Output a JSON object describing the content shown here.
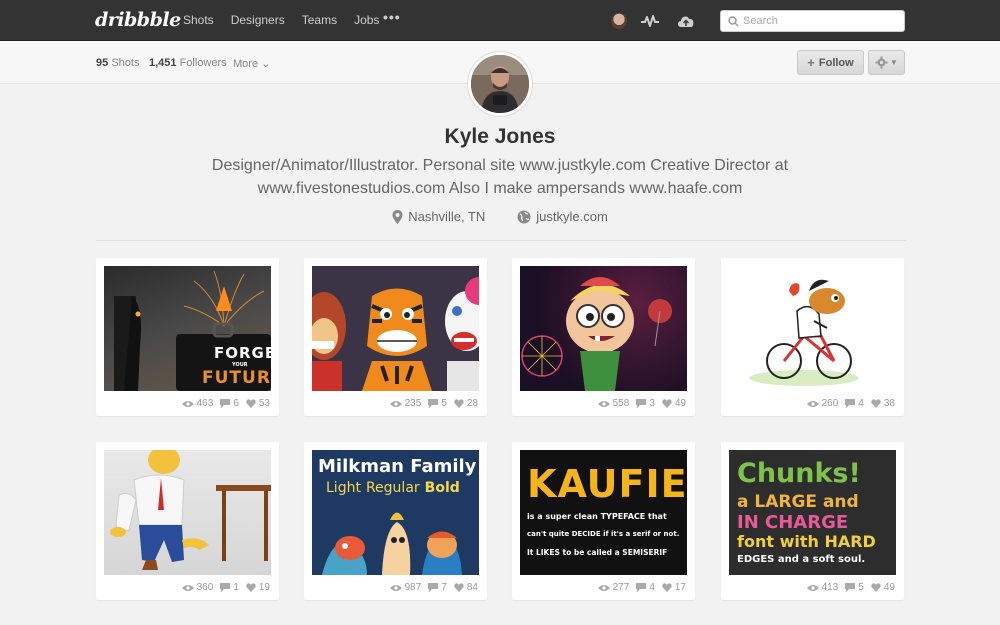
{
  "topnav": {
    "logo": "dribbble",
    "links": [
      "Shots",
      "Designers",
      "Teams",
      "Jobs"
    ],
    "more": "•••",
    "search_placeholder": "Search"
  },
  "subbar": {
    "shots_count": "95",
    "shots_label": "Shots",
    "followers_count": "1,451",
    "followers_label": "Followers",
    "more_label": "More",
    "follow_label": "Follow"
  },
  "profile": {
    "name": "Kyle Jones",
    "bio_line1": "Designer/Animator/Illustrator. Personal site www.justkyle.com Creative Director at",
    "bio_line2": "www.fivestonestudios.com Also I make ampersands www.haafe.com",
    "location": "Nashville, TN",
    "website": "justkyle.com"
  },
  "shots": [
    {
      "views": "463",
      "comments": "6",
      "likes": "53",
      "art": {
        "line1": "FORGE",
        "line2": "YOUR",
        "line3": "FUTUR"
      }
    },
    {
      "views": "235",
      "comments": "5",
      "likes": "28"
    },
    {
      "views": "558",
      "comments": "3",
      "likes": "49"
    },
    {
      "views": "260",
      "comments": "4",
      "likes": "38"
    },
    {
      "views": "360",
      "comments": "1",
      "likes": "19"
    },
    {
      "views": "987",
      "comments": "7",
      "likes": "84",
      "art": {
        "line1": "Milkman Family",
        "line2a": "Light",
        "line2b": "Regular",
        "line2c": "Bold"
      }
    },
    {
      "views": "277",
      "comments": "4",
      "likes": "17",
      "art": {
        "line1": "KAUFIE",
        "line2": "is a super clean TYPEFACE that",
        "line3": "can't quite DECIDE if it's a serif or not.",
        "line4": "It LIKES to be called a SEMISERIF"
      }
    },
    {
      "views": "413",
      "comments": "5",
      "likes": "49",
      "art": {
        "line1": "Chunks!",
        "line2": "a LARGE and",
        "line3": "IN CHARGE",
        "line4": "font with HARD",
        "line5": "EDGES and a soft soul."
      }
    }
  ],
  "colors": {
    "nav_bg": "#333333",
    "page_bg": "#f2f2f2",
    "text_dark": "#333333",
    "text_muted": "#999999"
  }
}
